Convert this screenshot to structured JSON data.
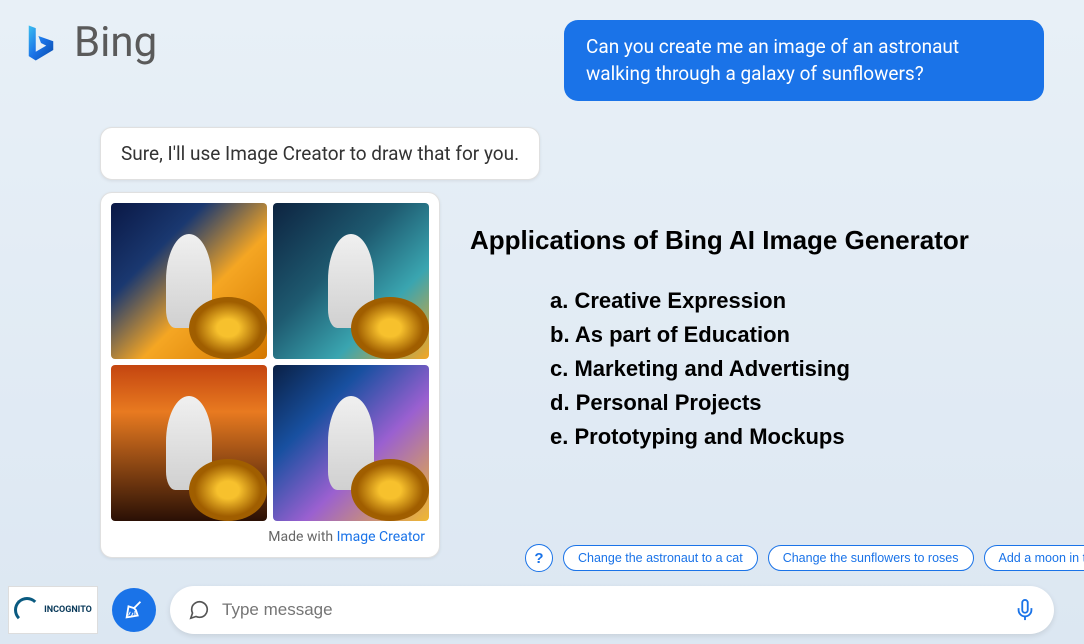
{
  "brand": "Bing",
  "user_message": "Can you create me an image of an astronaut walking through a galaxy of sunflowers?",
  "bot_message": "Sure, I'll use Image Creator to draw that for you.",
  "made_with_prefix": "Made with ",
  "made_with_link": "Image Creator",
  "content": {
    "title": "Applications of Bing AI Image Generator",
    "items": [
      "a. Creative Expression",
      "b. As part of Education",
      "c. Marketing and Advertising",
      "d. Personal Projects",
      "e. Prototyping and Mockups"
    ]
  },
  "help_label": "?",
  "suggestions": [
    "Change the astronaut to a cat",
    "Change the sunflowers to roses",
    "Add a moon in the background"
  ],
  "incognito_label": "INCOGNITO",
  "input_placeholder": "Type message"
}
